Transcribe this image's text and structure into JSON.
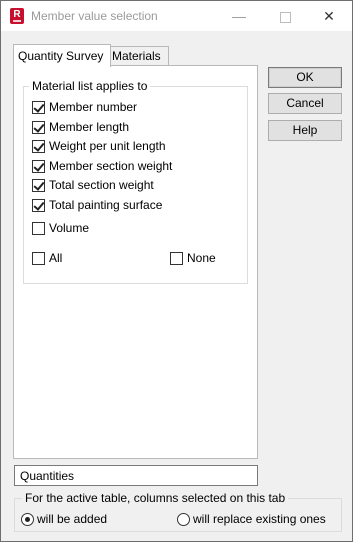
{
  "window": {
    "title": "Member value selection",
    "app_icon_letter": "R",
    "controls": {
      "minimize": "—",
      "maximize": "",
      "close": "✕"
    }
  },
  "tabs": [
    {
      "label": "Quantity Survey",
      "active": true
    },
    {
      "label": "Materials",
      "active": false
    }
  ],
  "material_group": {
    "label": "Material list applies to",
    "items": [
      {
        "label": "Member number",
        "checked": true
      },
      {
        "label": "Member length",
        "checked": true
      },
      {
        "label": "Weight per unit length",
        "checked": true
      },
      {
        "label": "Member section weight",
        "checked": true
      },
      {
        "label": "Total section weight",
        "checked": true
      },
      {
        "label": "Total painting surface",
        "checked": true
      },
      {
        "label": "Volume",
        "checked": false
      }
    ],
    "all_label": "All",
    "none_label": "None"
  },
  "buttons": {
    "ok": "OK",
    "cancel": "Cancel",
    "help": "Help"
  },
  "name_field": {
    "value": "Quantities"
  },
  "columns_group": {
    "label": "For the active table, columns selected on this tab",
    "option_add": "will be added",
    "option_replace": "will replace existing ones",
    "selected": "add"
  }
}
